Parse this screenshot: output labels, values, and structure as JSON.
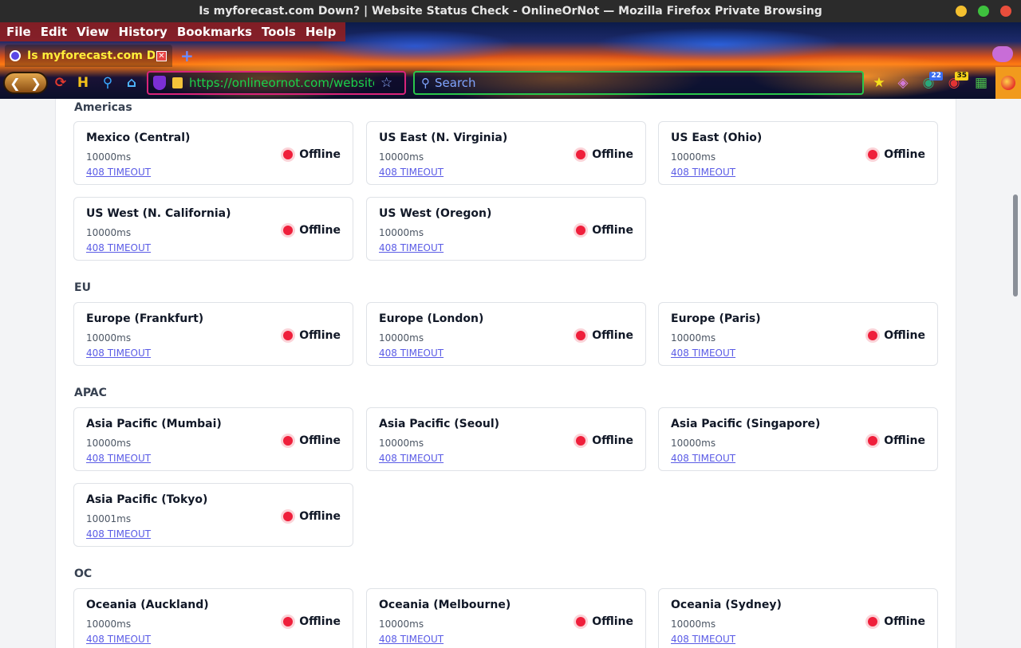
{
  "window": {
    "title": "Is myforecast.com Down? | Website Status Check - OnlineOrNot — Mozilla Firefox Private Browsing"
  },
  "menu": [
    "File",
    "Edit",
    "View",
    "History",
    "Bookmarks",
    "Tools",
    "Help"
  ],
  "tab": {
    "title": "Is myforecast.com Down?"
  },
  "urlbar": {
    "url": "https://onlineornot.com/website-do"
  },
  "search": {
    "placeholder": "Search"
  },
  "badges": {
    "extA": "22",
    "extB": "35"
  },
  "colors": {
    "offline": "#ef1f3b",
    "link": "#5b5ce6",
    "url": "#19d24c"
  },
  "regions": [
    {
      "label": "Americas",
      "cards": [
        {
          "name": "Mexico (Central)",
          "ms": "10000ms",
          "error": "408 TIMEOUT",
          "status": "Offline"
        },
        {
          "name": "US East (N. Virginia)",
          "ms": "10000ms",
          "error": "408 TIMEOUT",
          "status": "Offline"
        },
        {
          "name": "US East (Ohio)",
          "ms": "10000ms",
          "error": "408 TIMEOUT",
          "status": "Offline"
        },
        {
          "name": "US West (N. California)",
          "ms": "10000ms",
          "error": "408 TIMEOUT",
          "status": "Offline"
        },
        {
          "name": "US West (Oregon)",
          "ms": "10000ms",
          "error": "408 TIMEOUT",
          "status": "Offline"
        }
      ]
    },
    {
      "label": "EU",
      "cards": [
        {
          "name": "Europe (Frankfurt)",
          "ms": "10000ms",
          "error": "408 TIMEOUT",
          "status": "Offline"
        },
        {
          "name": "Europe (London)",
          "ms": "10000ms",
          "error": "408 TIMEOUT",
          "status": "Offline"
        },
        {
          "name": "Europe (Paris)",
          "ms": "10000ms",
          "error": "408 TIMEOUT",
          "status": "Offline"
        }
      ]
    },
    {
      "label": "APAC",
      "cards": [
        {
          "name": "Asia Pacific (Mumbai)",
          "ms": "10000ms",
          "error": "408 TIMEOUT",
          "status": "Offline"
        },
        {
          "name": "Asia Pacific (Seoul)",
          "ms": "10000ms",
          "error": "408 TIMEOUT",
          "status": "Offline"
        },
        {
          "name": "Asia Pacific (Singapore)",
          "ms": "10000ms",
          "error": "408 TIMEOUT",
          "status": "Offline"
        },
        {
          "name": "Asia Pacific (Tokyo)",
          "ms": "10001ms",
          "error": "408 TIMEOUT",
          "status": "Offline"
        }
      ]
    },
    {
      "label": "OC",
      "cards": [
        {
          "name": "Oceania (Auckland)",
          "ms": "10000ms",
          "error": "408 TIMEOUT",
          "status": "Offline"
        },
        {
          "name": "Oceania (Melbourne)",
          "ms": "10000ms",
          "error": "408 TIMEOUT",
          "status": "Offline"
        },
        {
          "name": "Oceania (Sydney)",
          "ms": "10000ms",
          "error": "408 TIMEOUT",
          "status": "Offline"
        }
      ]
    }
  ]
}
